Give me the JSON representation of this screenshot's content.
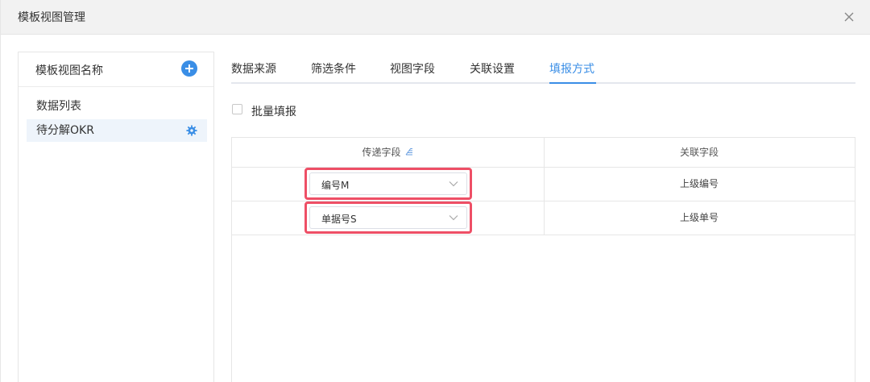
{
  "dialog": {
    "title": "模板视图管理",
    "close_icon": "close-icon"
  },
  "left_panel": {
    "title": "模板视图名称",
    "add_icon": "plus-circle-icon",
    "items": [
      {
        "label": "数据列表",
        "active": false
      },
      {
        "label": "待分解OKR",
        "active": true,
        "icon": "gear-icon"
      }
    ]
  },
  "tabs": [
    {
      "label": "数据来源",
      "active": false
    },
    {
      "label": "筛选条件",
      "active": false
    },
    {
      "label": "视图字段",
      "active": false
    },
    {
      "label": "关联设置",
      "active": false
    },
    {
      "label": "填报方式",
      "active": true
    }
  ],
  "batch": {
    "label": "批量填报",
    "checked": false
  },
  "table": {
    "columns": [
      "传递字段",
      "关联字段"
    ],
    "sort_icon": "sort-icon",
    "rows": [
      {
        "field_select": "编号M",
        "related": "上级编号"
      },
      {
        "field_select": "单据号S",
        "related": "上级单号"
      }
    ]
  },
  "colors": {
    "accent": "#3a8ee6",
    "highlight": "#ee4f66"
  }
}
